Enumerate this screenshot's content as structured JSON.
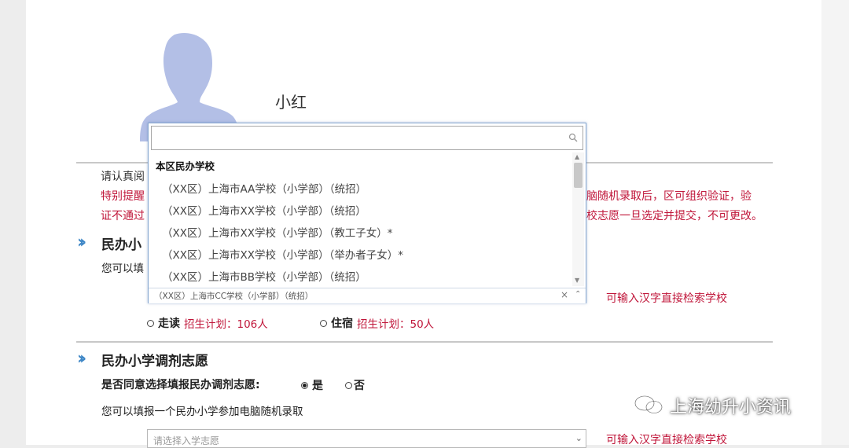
{
  "student": {
    "name": "小红"
  },
  "notice": {
    "line1": "请认真阅",
    "line2_left": "特别提醒",
    "line2_right": "脑随机录取后，区可组织验证，验",
    "line3_left": "证不通过",
    "line3_right": "校志愿一旦选定并提交，不可更改。"
  },
  "section1": {
    "title": "民办小",
    "subtitle": "您可以填",
    "hint": "可输入汉字直接检索学校",
    "options": [
      {
        "label": "走读",
        "plan_label": "招生计划：106人",
        "checked": false
      },
      {
        "label": "住宿",
        "plan_label": "招生计划：50人",
        "checked": false
      }
    ]
  },
  "section2": {
    "title": "民办小学调剂志愿",
    "question": "是否同意选择填报民办调剂志愿:",
    "yes_label": "是",
    "no_label": "否",
    "yes_checked": true,
    "instruction": "您可以填报一个民办小学参加电脑随机录取",
    "select_placeholder": "请选择入学志愿",
    "hint": "可输入汉字直接检索学校"
  },
  "dropdown": {
    "search_value": "",
    "group_label": "本区民办学校",
    "items": [
      "（XX区）上海市AA学校（小学部）（统招）",
      "（XX区）上海市XX学校（小学部）（统招）",
      "（XX区）上海市XX学校（小学部）（教工子女）*",
      "（XX区）上海市XX学校（小学部）（举办者子女）*",
      "（XX区）上海市BB学校（小学部）（统招）"
    ],
    "selected_value": "（XX区）上海市CC学校（小学部）（统招）"
  },
  "watermark": {
    "text": "上海幼升小资讯"
  },
  "colors": {
    "accent_red": "#c0163a",
    "chevron_blue": "#3d86c6",
    "avatar": "#b3bfe6"
  }
}
